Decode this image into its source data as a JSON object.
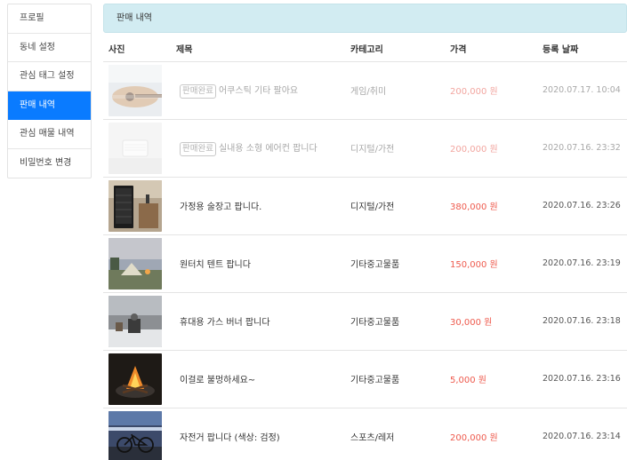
{
  "sidebar": {
    "items": [
      {
        "label": "프로필",
        "active": false
      },
      {
        "label": "동네 설정",
        "active": false
      },
      {
        "label": "관심 태그 설정",
        "active": false
      },
      {
        "label": "판매 내역",
        "active": true
      },
      {
        "label": "관심 매물 내역",
        "active": false
      },
      {
        "label": "비밀번호 변경",
        "active": false
      }
    ]
  },
  "main": {
    "banner": "판매 내역",
    "columns": {
      "photo": "사진",
      "title": "제목",
      "category": "카테고리",
      "price": "가격",
      "date": "등록 날짜"
    },
    "rows": [
      {
        "badge": "판매완료",
        "title": "어쿠스틱 기타 팔아요",
        "category": "게임/취미",
        "price": "200,000 원",
        "date": "2020.07.17. 10:04",
        "image": "guitar-photo"
      },
      {
        "badge": "판매완료",
        "title": "실내용 소형 에어컨 팝니다",
        "category": "디지털/가전",
        "price": "200,000 원",
        "date": "2020.07.16. 23:32",
        "image": "air-conditioner-photo"
      },
      {
        "badge": "",
        "title": "가정용 술장고 팝니다.",
        "category": "디지털/가전",
        "price": "380,000 원",
        "date": "2020.07.16. 23:26",
        "image": "wine-fridge-photo"
      },
      {
        "badge": "",
        "title": "원터치 텐트 팝니다",
        "category": "기타중고물품",
        "price": "150,000 원",
        "date": "2020.07.16. 23:19",
        "image": "tent-photo"
      },
      {
        "badge": "",
        "title": "휴대용 가스 버너 팝니다",
        "category": "기타중고물품",
        "price": "30,000 원",
        "date": "2020.07.16. 23:18",
        "image": "gas-burner-photo"
      },
      {
        "badge": "",
        "title": "이걸로 불멍하세요~",
        "category": "기타중고물품",
        "price": "5,000 원",
        "date": "2020.07.16. 23:16",
        "image": "campfire-photo"
      },
      {
        "badge": "",
        "title": "자전거 팝니다 (색상: 검정)",
        "category": "스포츠/레저",
        "price": "200,000 원",
        "date": "2020.07.16. 23:14",
        "image": "bicycle-photo"
      }
    ]
  },
  "colors": {
    "accent": "#0a7bff",
    "banner_bg": "#d2ecf2",
    "price": "#ee5a4d"
  }
}
